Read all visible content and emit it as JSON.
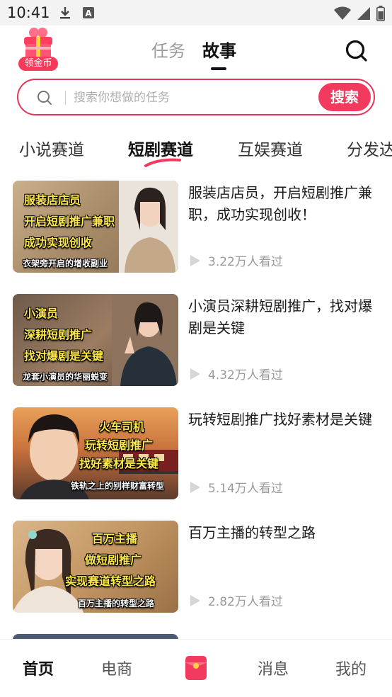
{
  "status_bar": {
    "time": "10:41",
    "icons": [
      "download-icon",
      "a-badge-icon",
      "wifi-icon",
      "signal-icon",
      "battery-icon"
    ]
  },
  "header": {
    "logo_label": "领金币",
    "tabs": [
      {
        "label": "任务",
        "active": false
      },
      {
        "label": "故事",
        "active": true
      }
    ],
    "search_icon": "search-icon"
  },
  "search": {
    "placeholder": "搜索你想做的任务",
    "button_label": "搜索"
  },
  "categories": [
    {
      "label": "小说赛道",
      "active": false
    },
    {
      "label": "短剧赛道",
      "active": true
    },
    {
      "label": "互娱赛道",
      "active": false
    },
    {
      "label": "分发达",
      "active": false
    }
  ],
  "items": [
    {
      "title": "服装店店员，开启短剧推广兼职，成功实现创收！",
      "views": "3.22万人看过",
      "thumb_lines": [
        "服装店店员",
        "开启短剧推广兼职",
        "成功实现创收"
      ],
      "thumb_caption": "衣架旁开启的增收副业"
    },
    {
      "title": "小演员深耕短剧推广，找对爆剧是关键",
      "views": "4.32万人看过",
      "thumb_lines": [
        "小演员",
        "深耕短剧推广",
        "找对爆剧是关键"
      ],
      "thumb_caption": "龙套小演员的华丽蜕变"
    },
    {
      "title": "玩转短剧推广找好素材是关键",
      "views": "5.14万人看过",
      "thumb_lines": [
        "火车司机",
        "玩转短剧推广",
        "找好素材是关键"
      ],
      "thumb_caption": "铁轨之上的别样财富转型"
    },
    {
      "title": "百万主播的转型之路",
      "views": "2.82万人看过",
      "thumb_lines": [
        "百万主播",
        "做短剧推广",
        "实现赛道转型之路"
      ],
      "thumb_caption": "百万主播的转型之路"
    }
  ],
  "bottom_nav": [
    {
      "label": "首页",
      "active": true
    },
    {
      "label": "电商",
      "active": false
    },
    {
      "label": "",
      "icon": "red-envelope-icon"
    },
    {
      "label": "消息",
      "active": false
    },
    {
      "label": "我的",
      "active": false
    }
  ],
  "colors": {
    "accent": "#f23a5f",
    "text": "#1a1a1a",
    "muted": "#9a9a9a",
    "caption_yellow": "#ffe94a"
  }
}
